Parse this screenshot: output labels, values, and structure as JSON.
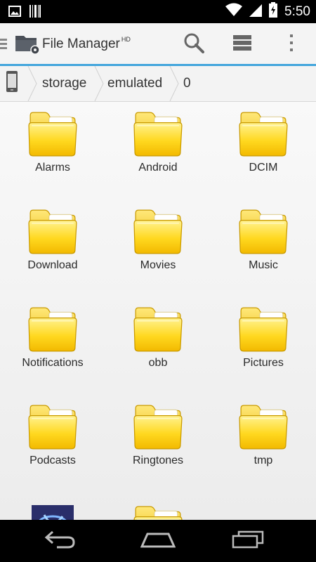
{
  "status_bar": {
    "time": "5:50"
  },
  "app_bar": {
    "title": "File Manager",
    "title_suffix": "HD"
  },
  "breadcrumb": [
    "storage",
    "emulated",
    "0"
  ],
  "folders": [
    {
      "name": "Alarms"
    },
    {
      "name": "Android"
    },
    {
      "name": "DCIM"
    },
    {
      "name": "Download"
    },
    {
      "name": "Movies"
    },
    {
      "name": "Music"
    },
    {
      "name": "Notifications"
    },
    {
      "name": "obb"
    },
    {
      "name": "Pictures"
    },
    {
      "name": "Podcasts"
    },
    {
      "name": "Ringtones"
    },
    {
      "name": "tmp"
    }
  ],
  "colors": {
    "accent": "#41a5dc",
    "folder": "#f7d21b"
  }
}
